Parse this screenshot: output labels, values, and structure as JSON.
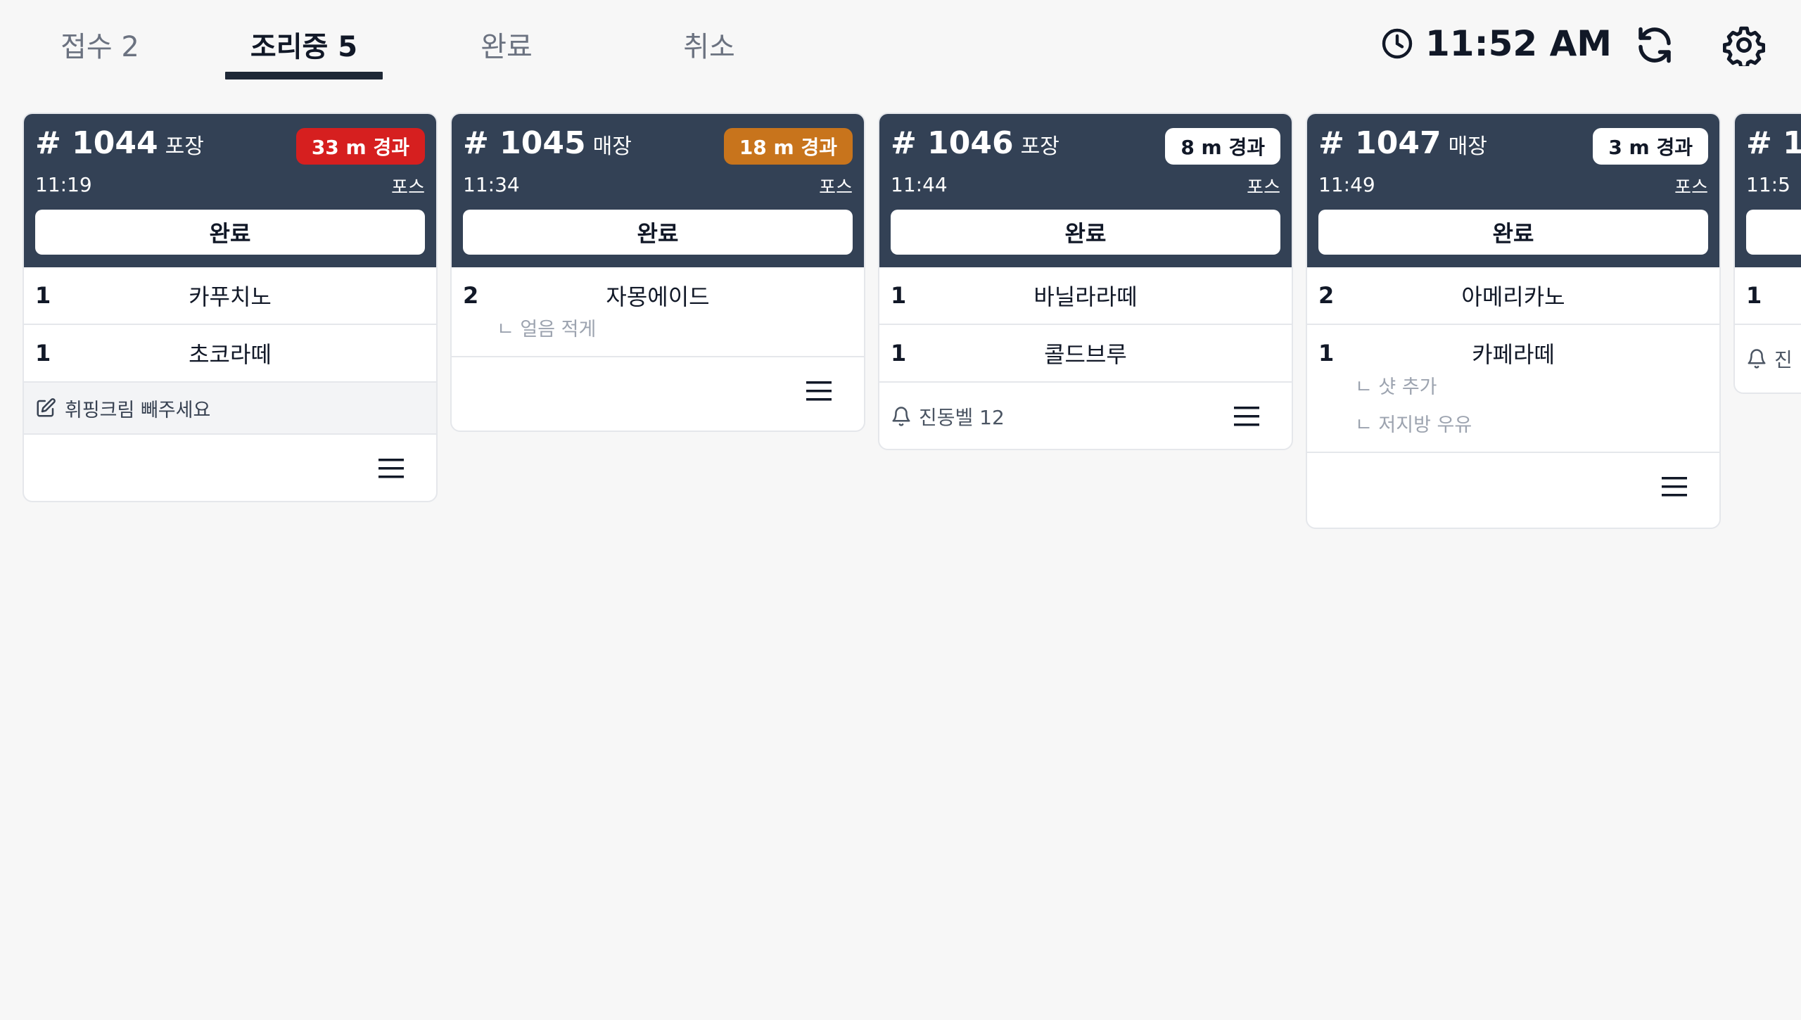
{
  "tabs": [
    {
      "label": "접수 2",
      "active": false
    },
    {
      "label": "조리중 5",
      "active": true
    },
    {
      "label": "완료",
      "active": false
    },
    {
      "label": "취소",
      "active": false
    }
  ],
  "header": {
    "clock": "11:52 AM",
    "icons": [
      "clock-icon",
      "refresh-icon",
      "gear-icon"
    ]
  },
  "colors": {
    "card_header": "#334155",
    "badge_red": "#d61f1f",
    "badge_orange": "#c8741c",
    "badge_white": "#ffffff"
  },
  "orders": [
    {
      "number": "# 1044",
      "type": "포장",
      "elapsed": "33 m 경과",
      "elapsed_level": "red",
      "time": "11:19",
      "source": "포스",
      "done_label": "완료",
      "items": [
        {
          "qty": "1",
          "name": "카푸치노",
          "options": []
        },
        {
          "qty": "1",
          "name": "초코라떼",
          "options": []
        }
      ],
      "memo": "휘핑크림 빼주세요",
      "bell": ""
    },
    {
      "number": "# 1045",
      "type": "매장",
      "elapsed": "18 m 경과",
      "elapsed_level": "orange",
      "time": "11:34",
      "source": "포스",
      "done_label": "완료",
      "items": [
        {
          "qty": "2",
          "name": "자몽에이드",
          "options": [
            "ㄴ 얼음 적게"
          ]
        }
      ],
      "memo": "",
      "bell": ""
    },
    {
      "number": "# 1046",
      "type": "포장",
      "elapsed": "8 m 경과",
      "elapsed_level": "white",
      "time": "11:44",
      "source": "포스",
      "done_label": "완료",
      "items": [
        {
          "qty": "1",
          "name": "바닐라라떼",
          "options": []
        },
        {
          "qty": "1",
          "name": "콜드브루",
          "options": []
        }
      ],
      "memo": "",
      "bell": "진동벨 12"
    },
    {
      "number": "# 1047",
      "type": "매장",
      "elapsed": "3 m 경과",
      "elapsed_level": "white",
      "time": "11:49",
      "source": "포스",
      "done_label": "완료",
      "items": [
        {
          "qty": "2",
          "name": "아메리카노",
          "options": []
        },
        {
          "qty": "1",
          "name": "카페라떼",
          "options": [
            "ㄴ 샷 추가",
            "ㄴ 저지방 우유"
          ]
        }
      ],
      "memo": "",
      "bell": ""
    },
    {
      "number": "# 1",
      "type": "",
      "elapsed": "",
      "elapsed_level": "white",
      "time": "11:5",
      "source": "",
      "done_label": "",
      "items": [
        {
          "qty": "1",
          "name": "",
          "options": []
        }
      ],
      "memo": "",
      "bell": "진"
    }
  ]
}
